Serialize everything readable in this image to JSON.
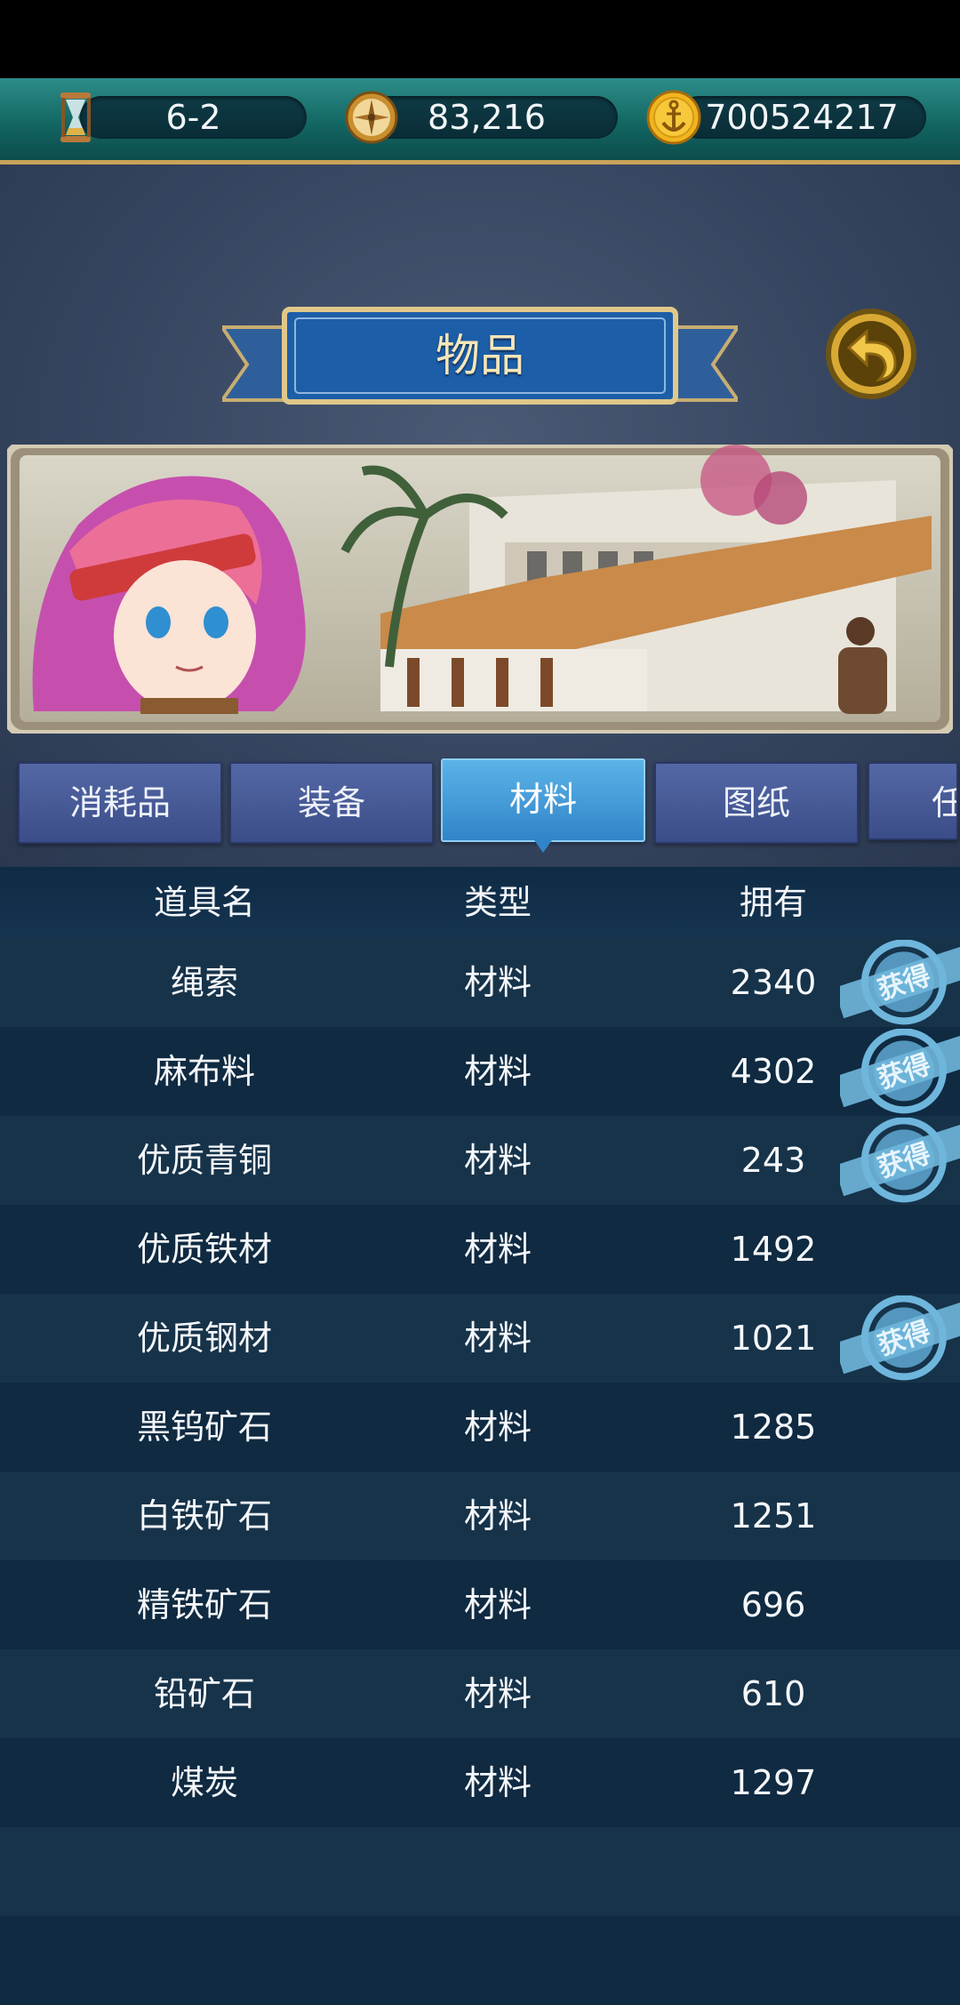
{
  "topbar": {
    "stage": "6-2",
    "compass": "83,216",
    "gold": "700524217",
    "icons": [
      "hourglass-icon",
      "compass-icon",
      "anchor-coin-icon"
    ]
  },
  "title": "物品",
  "tabs": [
    {
      "label": "消耗品",
      "active": false
    },
    {
      "label": "装备",
      "active": false
    },
    {
      "label": "材料",
      "active": true
    },
    {
      "label": "图纸",
      "active": false
    },
    {
      "label": "任",
      "active": false
    }
  ],
  "table": {
    "headers": {
      "name": "道具名",
      "type": "类型",
      "owned": "拥有"
    },
    "rows": [
      {
        "name": "绳索",
        "type": "材料",
        "owned": "2340",
        "obtain": true
      },
      {
        "name": "麻布料",
        "type": "材料",
        "owned": "4302",
        "obtain": true
      },
      {
        "name": "优质青铜",
        "type": "材料",
        "owned": "243",
        "obtain": true
      },
      {
        "name": "优质铁材",
        "type": "材料",
        "owned": "1492",
        "obtain": false
      },
      {
        "name": "优质钢材",
        "type": "材料",
        "owned": "1021",
        "obtain": true
      },
      {
        "name": "黑钨矿石",
        "type": "材料",
        "owned": "1285",
        "obtain": false
      },
      {
        "name": "白铁矿石",
        "type": "材料",
        "owned": "1251",
        "obtain": false
      },
      {
        "name": "精铁矿石",
        "type": "材料",
        "owned": "696",
        "obtain": false
      },
      {
        "name": "铅矿石",
        "type": "材料",
        "owned": "610",
        "obtain": false
      },
      {
        "name": "煤炭",
        "type": "材料",
        "owned": "1297",
        "obtain": false
      }
    ],
    "stamp_text": "获得"
  },
  "colors": {
    "topbar": "#136763",
    "gold_trim": "#c8a45a",
    "active_tab": "#3184c8",
    "tab": "#3b4d88",
    "row_odd": "#16334a",
    "row_even": "#0f2a41",
    "stamp": "#6fb6dc"
  }
}
